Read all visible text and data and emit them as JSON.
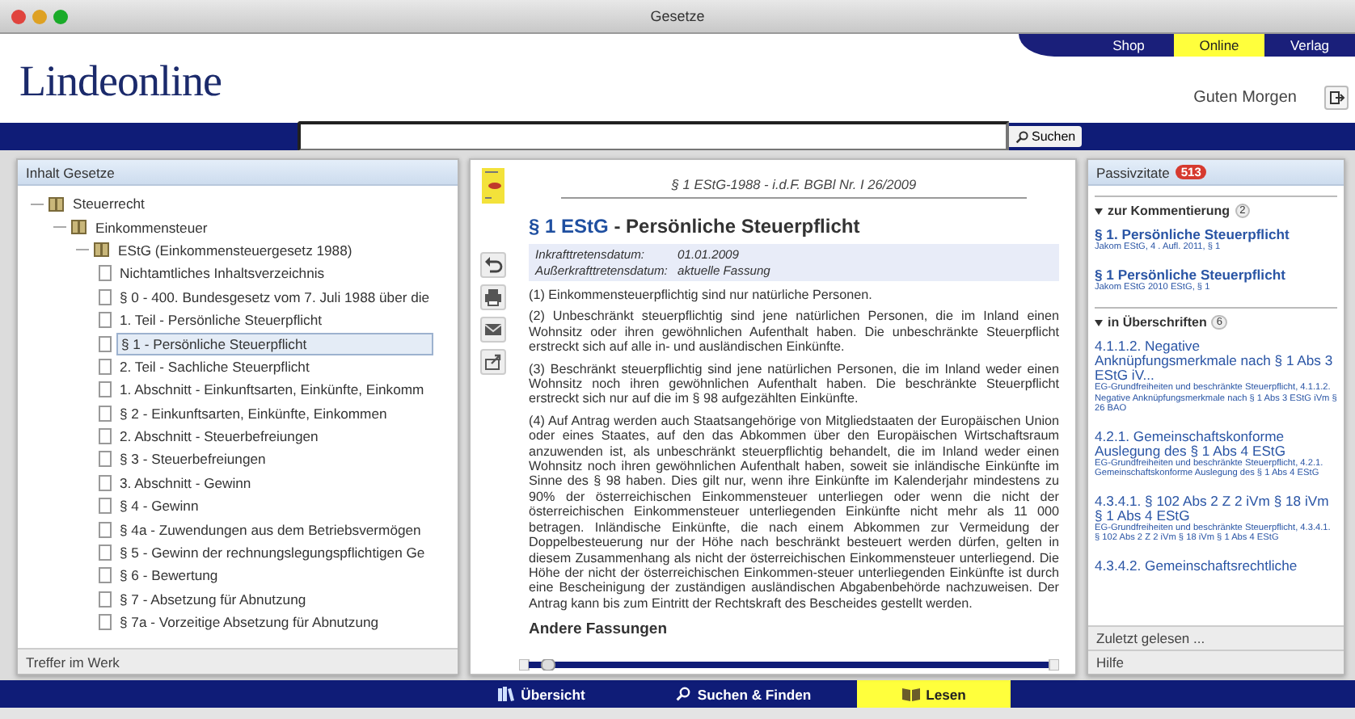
{
  "window": {
    "title": "Gesetze"
  },
  "header": {
    "logo": "Lindeonline",
    "greeting": "Guten Morgen",
    "nav": [
      {
        "label": "Shop",
        "selected": false
      },
      {
        "label": "Online",
        "selected": true
      },
      {
        "label": "Verlag",
        "selected": false
      }
    ]
  },
  "search": {
    "button": "Suchen"
  },
  "contents_panel": {
    "title": "Inhalt Gesetze",
    "footer": "Treffer im Werk",
    "tree": [
      {
        "label": "Steuerrecht",
        "selected": false,
        "children": [
          {
            "label": "Einkommensteuer",
            "selected": false,
            "children": [
              {
                "label": "EStG (Einkommensteuergesetz 1988)",
                "selected": false,
                "children": [
                  {
                    "label": "Nichtamtliches Inhaltsverzeichnis",
                    "selected": false
                  },
                  {
                    "label": "§ 0 - 400. Bundesgesetz vom 7. Juli 1988 über die",
                    "selected": false
                  },
                  {
                    "label": "1. Teil - Persönliche Steuerpflicht",
                    "selected": false
                  },
                  {
                    "label": "§ 1 - Persönliche Steuerpflicht",
                    "selected": true
                  },
                  {
                    "label": "2. Teil - Sachliche Steuerpflicht",
                    "selected": false
                  },
                  {
                    "label": "1. Abschnitt - Einkunftsarten, Einkünfte, Einkomm",
                    "selected": false
                  },
                  {
                    "label": "§ 2 - Einkunftsarten, Einkünfte, Einkommen",
                    "selected": false
                  },
                  {
                    "label": "2. Abschnitt - Steuerbefreiungen",
                    "selected": false
                  },
                  {
                    "label": "§ 3 - Steuerbefreiungen",
                    "selected": false
                  },
                  {
                    "label": "3. Abschnitt - Gewinn",
                    "selected": false
                  },
                  {
                    "label": "§ 4 - Gewinn",
                    "selected": false
                  },
                  {
                    "label": "§ 4a - Zuwendungen aus dem Betriebsvermögen",
                    "selected": false
                  },
                  {
                    "label": "§ 5 - Gewinn der rechnungslegungspflichtigen Ge",
                    "selected": false
                  },
                  {
                    "label": "§ 6 - Bewertung",
                    "selected": false
                  },
                  {
                    "label": "§ 7 - Absetzung für Abnutzung",
                    "selected": false
                  },
                  {
                    "label": "§ 7a - Vorzeitige Absetzung für Abnutzung",
                    "selected": false
                  }
                ]
              }
            ]
          }
        ]
      }
    ]
  },
  "document": {
    "source": "§ 1 EStG-1988 - i.d.F. BGBl Nr. I 26/2009",
    "title_ref": "§ 1 EStG",
    "title_text": " - Persönliche Steuerpflicht",
    "meta": [
      {
        "label": "Inkrafttretensdatum:",
        "value": "01.01.2009"
      },
      {
        "label": "Außerkrafttretensdatum:",
        "value": "aktuelle Fassung"
      }
    ],
    "paragraphs": [
      "(1) Einkommensteuerpflichtig sind nur natürliche Personen.",
      "(2) Unbeschränkt steuerpflichtig sind jene natürlichen Personen, die im Inland einen Wohnsitz oder ihren gewöhnlichen Aufenthalt haben. Die unbeschränkte Steuerpflicht erstreckt sich auf alle in- und ausländischen Einkünfte.",
      "(3) Beschränkt steuerpflichtig sind jene natürlichen Personen, die im Inland weder einen Wohnsitz noch ihren gewöhnlichen Aufenthalt haben. Die beschränkte Steuerpflicht erstreckt sich nur auf die im § 98 aufgezählten Einkünfte.",
      "(4) Auf Antrag werden auch Staatsangehörige von Mitgliedstaaten der Europäischen Union oder eines Staates, auf den das Abkommen über den Europäischen Wirtschaftsraum anzuwenden ist, als unbeschränkt steuerpflichtig behandelt, die im Inland weder einen Wohnsitz noch ihren gewöhnlichen Aufenthalt haben, soweit sie inländische Einkünfte im Sinne des § 98 haben. Dies gilt nur, wenn ihre Einkünfte im Kalenderjahr mindestens zu 90% der österreichischen Einkommensteuer unterliegen oder wenn die nicht der österreichischen Einkommensteuer unterliegenden Einkünfte nicht mehr als 11 000 betragen. Inländische Einkünfte, die nach einem Abkommen zur Vermeidung der Doppelbesteuerung nur der Höhe nach beschränkt besteuert werden dürfen, gelten in diesem Zusammenhang als nicht der österreichischen Einkommensteuer unterliegend. Die Höhe der nicht der österreichischen Einkommen-steuer unterliegenden Einkünfte ist durch eine Bescheinigung der zuständigen ausländischen Abgabenbehörde nachzuweisen. Der Antrag kann bis zum Eintritt der Rechtskraft des Bescheides gestellt werden."
    ],
    "next_heading": "Andere Fassungen"
  },
  "citations_panel": {
    "title": "Passivzitate",
    "count": "513",
    "sections": [
      {
        "label": "zur Kommentierung",
        "count": "2",
        "expanded": true,
        "items": [
          {
            "title": "§ 1. Persönliche Steuerpflicht",
            "source": "Jakom EStG, 4 . Aufl. 2011, § 1"
          },
          {
            "title": "§ 1 Persönliche Steuerpflicht",
            "source": "Jakom EStG 2010 EStG, § 1"
          }
        ]
      },
      {
        "label": "in Überschriften",
        "count": "6",
        "expanded": true,
        "items": [
          {
            "title": "4.1.1.2. Negative Anknüpfungsmerkmale nach § 1 Abs 3 EStG iV...",
            "source": "EG-Grundfreiheiten und beschränkte Steuerpflicht, 4.1.1.2. Negative Anknüpfungsmerkmale nach § 1 Abs 3 EStG iVm § 26 BAO"
          },
          {
            "title": "4.2.1. Gemeinschaftskonforme Auslegung des § 1 Abs 4 EStG",
            "source": "EG-Grundfreiheiten und beschränkte Steuerpflicht, 4.2.1. Gemeinschaftskonforme Auslegung des § 1 Abs 4 EStG"
          },
          {
            "title": "4.3.4.1. § 102 Abs 2 Z 2 iVm § 18 iVm § 1 Abs 4 EStG",
            "source": "EG-Grundfreiheiten und beschränkte Steuerpflicht, 4.3.4.1. § 102 Abs 2 Z 2 iVm § 18 iVm § 1 Abs 4 EStG"
          },
          {
            "title": "4.3.4.2. Gemeinschaftsrechtliche"
          }
        ]
      }
    ],
    "links": [
      "Zuletzt gelesen ...",
      "Hilfe"
    ]
  },
  "bottom_nav": [
    {
      "label": "Übersicht",
      "kind": "overview",
      "selected": false
    },
    {
      "label": "Suchen & Finden",
      "kind": "search",
      "selected": false
    },
    {
      "label": "Lesen",
      "kind": "read",
      "selected": true
    }
  ]
}
